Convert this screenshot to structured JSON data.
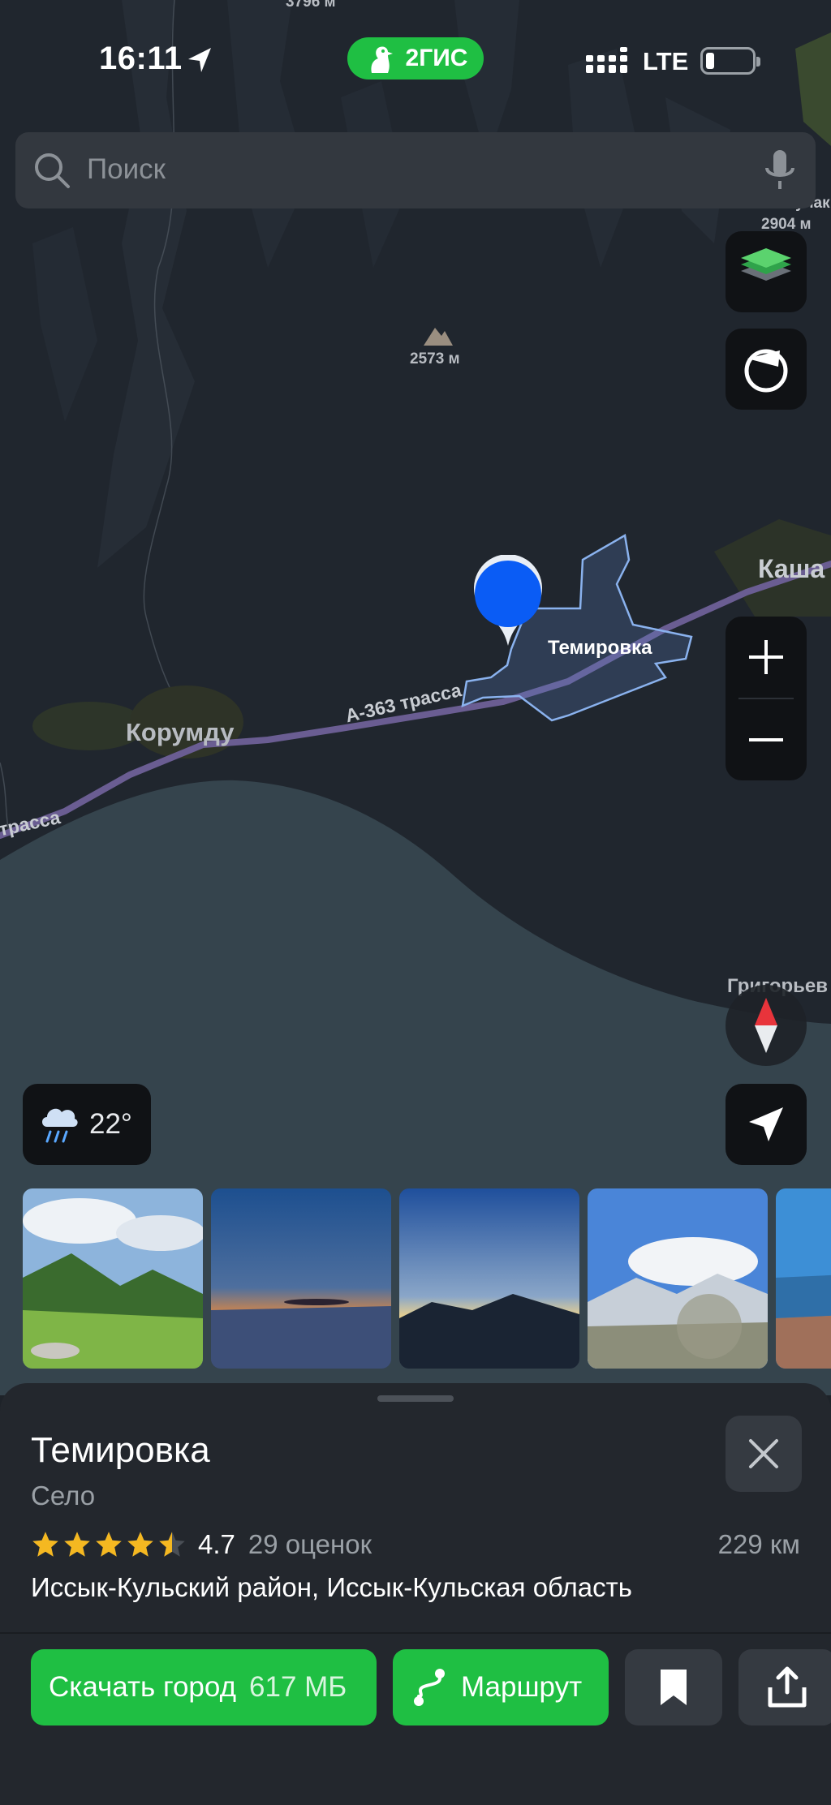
{
  "status_bar": {
    "time": "16:11",
    "brand": "2ГИС",
    "network": "LTE"
  },
  "search": {
    "placeholder": "Поиск"
  },
  "map": {
    "labels": {
      "top_peak": "3796 м",
      "peak_right": "2904 м",
      "peak_right_name": "Чоп-Булак",
      "peak": "2573 м",
      "village_kashka": "Каша",
      "selected_place": "Темировка",
      "village_korumdu": "Корумду",
      "road": "А-363 трасса",
      "road_left": "трасса",
      "grigorievka": "Григорьев"
    }
  },
  "weather": {
    "icon": "rain-cloud-icon",
    "temperature": "22°"
  },
  "place": {
    "name": "Темировка",
    "type": "Село",
    "rating": "4.7",
    "rating_stars": 4.5,
    "reviews": "29 оценок",
    "distance": "229 км",
    "address": "Иссык-Кульский район, Иссык-Кульская область"
  },
  "actions": {
    "download_label": "Скачать город",
    "download_size": "617 МБ",
    "route_label": "Маршрут"
  },
  "colors": {
    "accent_green": "#1fbf43",
    "pin_blue": "#0a5cf5",
    "star_yellow": "#f5b821"
  }
}
